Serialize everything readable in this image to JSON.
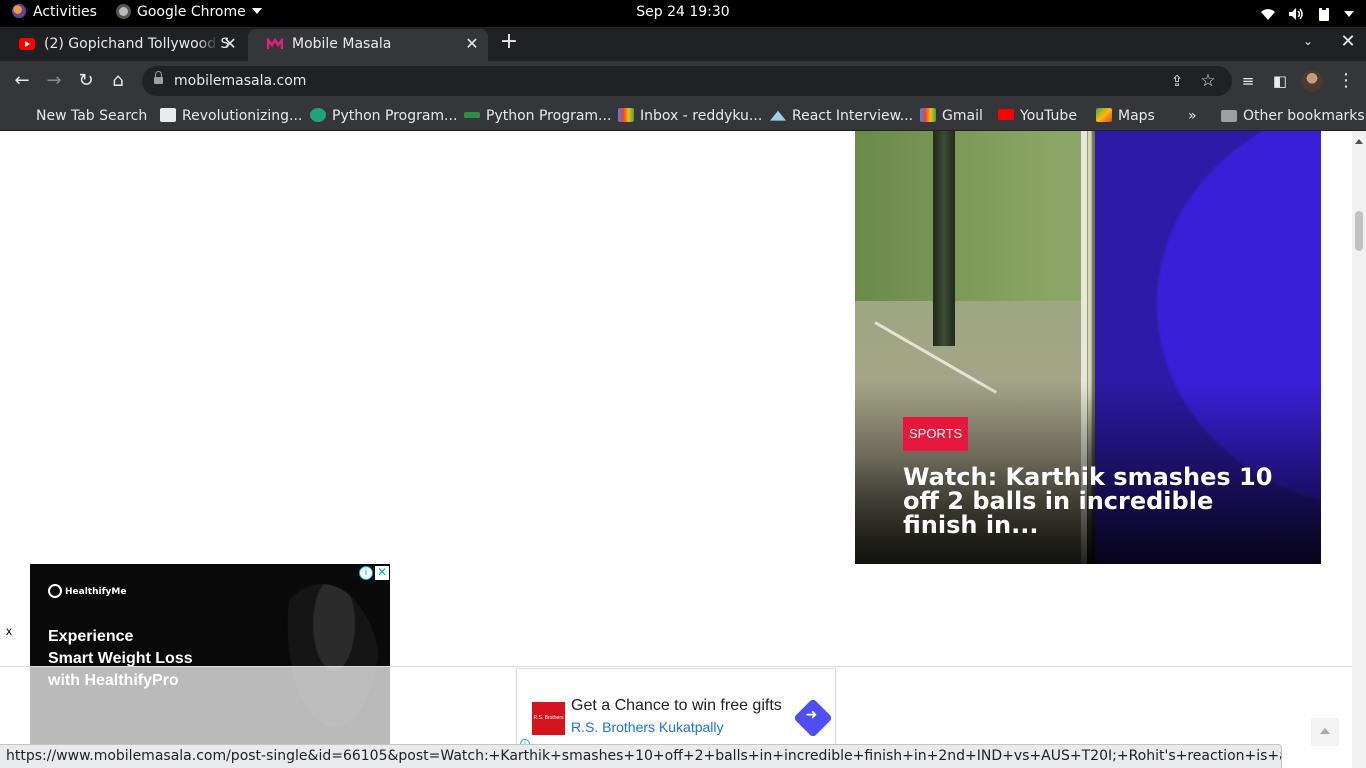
{
  "os": {
    "activities_label": "Activities",
    "app_menu_label": "Google Chrome",
    "clock": "Sep 24  19:30"
  },
  "browser": {
    "tabs": [
      {
        "title": "(2) Gopichand Tollywood S",
        "favicon": "youtube-icon"
      },
      {
        "title": "Mobile Masala",
        "favicon": "mobile-masala-icon"
      }
    ],
    "url": "mobilemasala.com",
    "bookmarks": [
      {
        "label": "New Tab Search",
        "icon": "search-icon"
      },
      {
        "label": "Revolutionizing...",
        "icon": "site-icon"
      },
      {
        "label": "Python Program...",
        "icon": "site-icon"
      },
      {
        "label": "Python Program...",
        "icon": "site-icon"
      },
      {
        "label": "Inbox - reddyku...",
        "icon": "gmail-icon"
      },
      {
        "label": "React Interview...",
        "icon": "site-icon"
      },
      {
        "label": "Gmail",
        "icon": "gmail-icon"
      },
      {
        "label": "YouTube",
        "icon": "youtube-icon"
      },
      {
        "label": "Maps",
        "icon": "maps-icon"
      }
    ],
    "more_bookmarks": "»",
    "other_bookmarks": "Other bookmarks",
    "status_url": "https://www.mobilemasala.com/post-single&id=66105&post=Watch:+Karthik+smashes+10+off+2+balls+in+incredible+finish+in+2nd+IND+vs+AUS+T20I;+Rohit's+reaction+is+absolute+gold"
  },
  "page": {
    "featured": {
      "category": "SPORTS",
      "headline": "Watch: Karthik smashes 10 off 2 balls in incredible finish in..."
    },
    "left_ad": {
      "brand": "HealthifyMe",
      "copy": "Experience\nSmart Weight Loss\nwith HealthifyPro",
      "dismiss": "x"
    },
    "bottom_ad": {
      "headline": "Get a Chance to win free gifts",
      "advertiser": "R.S. Brothers Kukatpally",
      "logo_text": "R.S. Brothers"
    }
  },
  "colors": {
    "accent_tag": "#e8163c",
    "chrome_dark": "#202124",
    "chrome_toolbar": "#35363a",
    "link_blue": "#1a73e8"
  }
}
